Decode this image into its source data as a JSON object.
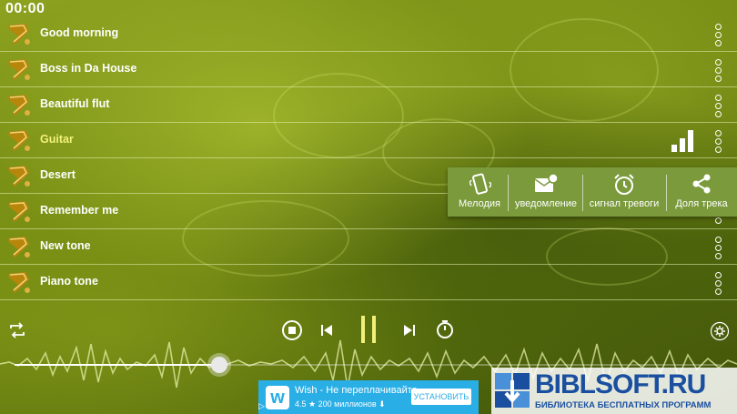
{
  "status_bar": {
    "time": "00:00"
  },
  "tracks": [
    {
      "name": "Good morning"
    },
    {
      "name": "Boss in Da House"
    },
    {
      "name": "Beautiful flut"
    },
    {
      "name": "Guitar"
    },
    {
      "name": "Desert"
    },
    {
      "name": "Remember me"
    },
    {
      "name": "New tone"
    },
    {
      "name": "Piano tone"
    }
  ],
  "active_track_index": 3,
  "context_menu": {
    "items": [
      {
        "label": "Мелодия",
        "icon": "phone-vibrate-icon"
      },
      {
        "label": "уведомление",
        "icon": "notification-envelope-icon"
      },
      {
        "label": "сигнал тревоги",
        "icon": "alarm-clock-icon"
      },
      {
        "label": "Доля трека",
        "icon": "share-icon"
      }
    ]
  },
  "player": {
    "progress": 0.29,
    "icons": [
      "repeat-icon",
      "stop-icon",
      "previous-icon",
      "pause-icon",
      "next-icon",
      "timer-icon",
      "settings-icon"
    ]
  },
  "ad": {
    "title": "Wish - Не переплачивайте",
    "rating": "4.5 ★",
    "installs": "200 миллионов",
    "button": "УСТАНОВИТЬ"
  },
  "watermark": {
    "title": "BIBLSOFT.RU",
    "subtitle": "БИБЛИОТЕКА БЕСПЛАТНЫХ ПРОГРАММ"
  },
  "colors": {
    "accent": "#f2f07a",
    "popup_bg": "#7a9a3c",
    "ad_bg": "#29aee6",
    "watermark": "#1a4fa0"
  }
}
